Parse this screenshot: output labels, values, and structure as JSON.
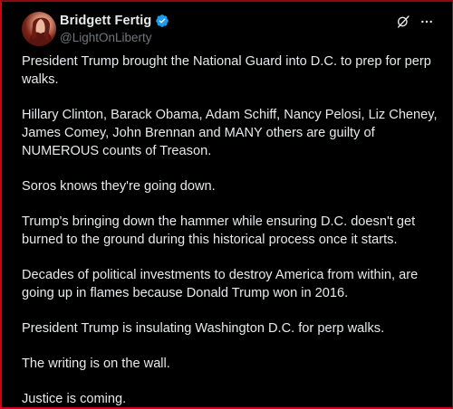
{
  "author": {
    "display_name": "Bridgett Fertig",
    "handle": "@LightOnLiberty",
    "verified": true,
    "verified_color": "#1d9bf0"
  },
  "actions": {
    "grok_icon": "grok-icon",
    "more_icon": "more-icon"
  },
  "post": {
    "paragraphs": [
      "President Trump brought the National Guard into D.C. to prep for perp walks.",
      "Hillary Clinton, Barack Obama, Adam Schiff, Nancy Pelosi, Liz Cheney, James Comey, John Brennan and MANY others are guilty of NUMEROUS counts of Treason.",
      "Soros knows they're going down.",
      "Trump's bringing down the hammer while ensuring D.C. doesn't get burned to the ground during this historical process once it starts.",
      "Decades of political investments to destroy America from within, are going up in flames because Donald Trump won in 2016.",
      "President Trump is insulating Washington D.C. for perp walks.",
      "The writing is on the wall.",
      "Justice is coming."
    ]
  },
  "colors": {
    "background": "#000000",
    "text": "#e7e9ea",
    "muted": "#71767b",
    "frame": "#d0021b"
  }
}
